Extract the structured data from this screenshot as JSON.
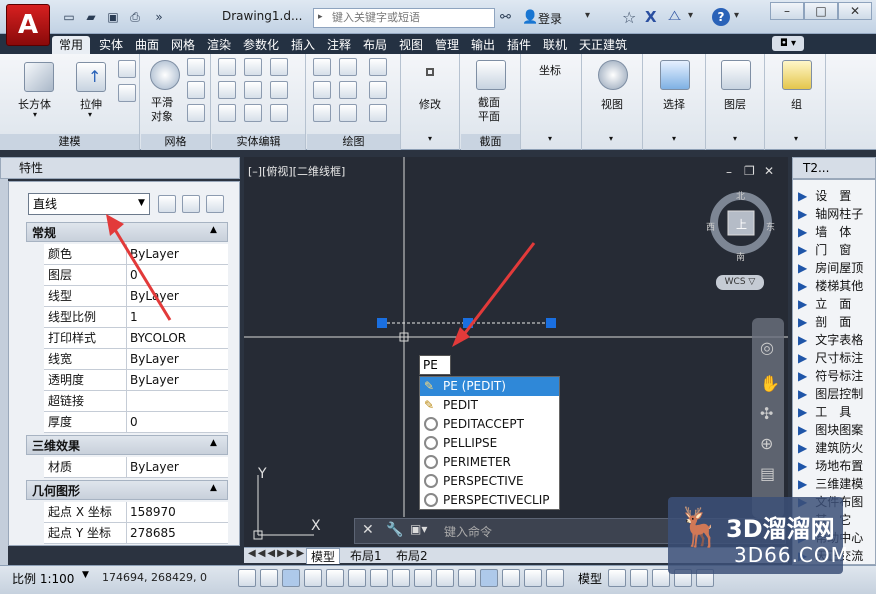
{
  "titlebar": {
    "app_letter": "A",
    "doc_title": "Drawing1.d...",
    "search_placeholder": "键入关键字或短语",
    "login": "登录",
    "help": "?",
    "min": "–",
    "max": "□",
    "close": "✕"
  },
  "tabs": [
    "常用",
    "实体",
    "曲面",
    "网格",
    "渲染",
    "参数化",
    "插入",
    "注释",
    "布局",
    "视图",
    "管理",
    "输出",
    "插件",
    "联机",
    "天正建筑"
  ],
  "ribbon": {
    "box_label": "长方体",
    "extrude_label": "拉伸",
    "smooth_label": "平滑\n对象",
    "modify_label": "修改",
    "section_plane_label": "截面\n平面",
    "coords_label": "坐标",
    "view_label": "视图",
    "select_label": "选择",
    "layer_label": "图层",
    "group_label": "组",
    "panels": [
      "建模",
      "网格",
      "实体编辑",
      "绘图",
      "截面"
    ]
  },
  "properties": {
    "header": "特性",
    "select_value": "直线",
    "sec_general": "常规",
    "rows_general": [
      {
        "k": "颜色",
        "v": "ByLayer"
      },
      {
        "k": "图层",
        "v": "0"
      },
      {
        "k": "线型",
        "v": "ByLayer"
      },
      {
        "k": "线型比例",
        "v": "1"
      },
      {
        "k": "打印样式",
        "v": "BYCOLOR"
      },
      {
        "k": "线宽",
        "v": "ByLayer"
      },
      {
        "k": "透明度",
        "v": "ByLayer"
      },
      {
        "k": "超链接",
        "v": ""
      },
      {
        "k": "厚度",
        "v": "0"
      }
    ],
    "sec_3d": "三维效果",
    "rows_3d": [
      {
        "k": "材质",
        "v": "ByLayer"
      }
    ],
    "sec_geom": "几何图形",
    "rows_geom": [
      {
        "k": "起点 X 坐标",
        "v": "158970"
      },
      {
        "k": "起点 Y 坐标",
        "v": "278685"
      }
    ]
  },
  "canvas": {
    "viewport_label": "[–][俯视][二维线框]",
    "compass": {
      "n": "北",
      "s": "南",
      "e": "东",
      "w": "西",
      "top": "上"
    },
    "wcs": "WCS ▽",
    "axis_y": "Y",
    "axis_x": "X"
  },
  "autocomplete": {
    "input": "PE",
    "items": [
      "PE (PEDIT)",
      "PEDIT",
      "PEDITACCEPT",
      "PELLIPSE",
      "PERIMETER",
      "PERSPECTIVE",
      "PERSPECTIVECLIP"
    ]
  },
  "cmdbar": {
    "placeholder": "键入命令"
  },
  "layout_tabs": [
    "模型",
    "布局1",
    "布局2"
  ],
  "status": {
    "scale": "比例 1:100",
    "coords": "174694, 268429, 0",
    "model": "模型"
  },
  "palette": {
    "header": "T2...",
    "items": [
      "设　置",
      "轴网柱子",
      "墙　体",
      "门　窗",
      "房间屋顶",
      "楼梯其他",
      "立　面",
      "剖　面",
      "文字表格",
      "尺寸标注",
      "符号标注",
      "图层控制",
      "工　具",
      "图块图案",
      "建筑防火",
      "场地布置",
      "三维建模",
      "文件布图",
      "其　它",
      "帮助中心",
      "天正交流"
    ]
  },
  "watermark": {
    "big": "3D溜溜网",
    "small": "3D66.COM"
  },
  "colors": {
    "accent": "#2f88d8",
    "canvas": "#262b35",
    "arrow": "#e23a3a",
    "grip": "#1a6fe0"
  }
}
